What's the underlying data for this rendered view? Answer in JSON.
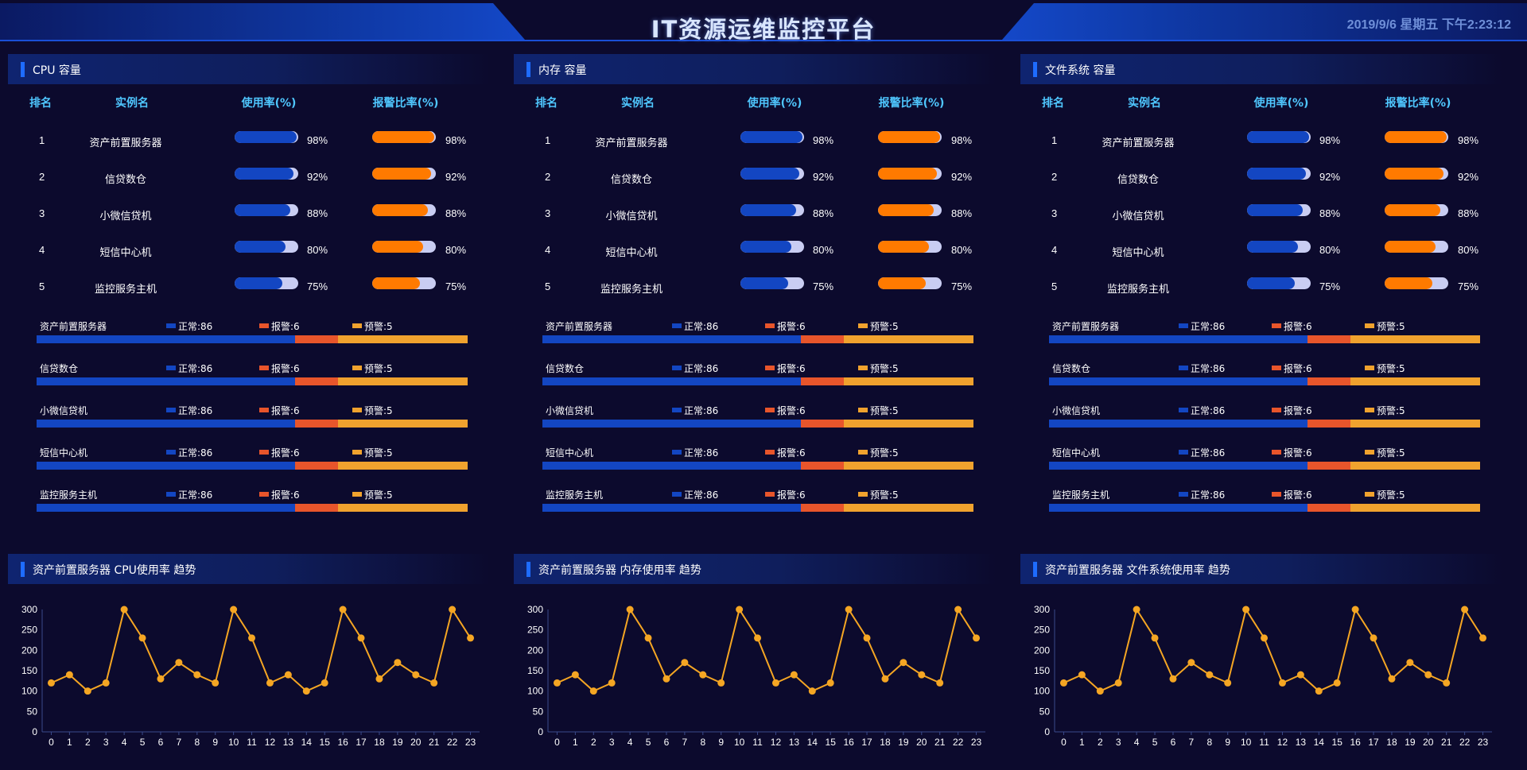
{
  "header": {
    "title": "IT资源运维监控平台",
    "datetime": "2019/9/6 星期五 下午2:23:12"
  },
  "colors": {
    "usage": "#1346c2",
    "alarm": "#ff7a00",
    "track": "#c9cdf2",
    "normal": "#1346c2",
    "warn": "#e8552b",
    "pre": "#f0a22e",
    "line": "#f5a623"
  },
  "columns": {
    "rank": "排名",
    "name": "实例名",
    "usage": "使用率(%)",
    "alarm": "报警比率(%)"
  },
  "panels": [
    {
      "title": "CPU 容量",
      "trend_title": "资产前置服务器 CPU使用率 趋势",
      "rows": [
        {
          "rank": "1",
          "name": "资产前置服务器",
          "usage": 98,
          "usage_text": "98%",
          "alarm": 98,
          "alarm_text": "98%"
        },
        {
          "rank": "2",
          "name": "信贷数仓",
          "usage": 92,
          "usage_text": "92%",
          "alarm": 92,
          "alarm_text": "92%"
        },
        {
          "rank": "3",
          "name": "小微信贷机",
          "usage": 88,
          "usage_text": "88%",
          "alarm": 88,
          "alarm_text": "88%"
        },
        {
          "rank": "4",
          "name": "短信中心机",
          "usage": 80,
          "usage_text": "80%",
          "alarm": 80,
          "alarm_text": "80%"
        },
        {
          "rank": "5",
          "name": "监控服务主机",
          "usage": 75,
          "usage_text": "75%",
          "alarm": 75,
          "alarm_text": "75%"
        }
      ],
      "stats": [
        {
          "name": "资产前置服务器",
          "normal": "正常:86",
          "warn": "报警:6",
          "pre": "预警:5"
        },
        {
          "name": "信贷数仓",
          "normal": "正常:86",
          "warn": "报警:6",
          "pre": "预警:5"
        },
        {
          "name": "小微信贷机",
          "normal": "正常:86",
          "warn": "报警:6",
          "pre": "预警:5"
        },
        {
          "name": "短信中心机",
          "normal": "正常:86",
          "warn": "报警:6",
          "pre": "预警:5"
        },
        {
          "name": "监控服务主机",
          "normal": "正常:86",
          "warn": "报警:6",
          "pre": "预警:5"
        }
      ]
    },
    {
      "title": "内存 容量",
      "trend_title": "资产前置服务器 内存使用率 趋势",
      "rows": [
        {
          "rank": "1",
          "name": "资产前置服务器",
          "usage": 98,
          "usage_text": "98%",
          "alarm": 98,
          "alarm_text": "98%"
        },
        {
          "rank": "2",
          "name": "信贷数仓",
          "usage": 92,
          "usage_text": "92%",
          "alarm": 92,
          "alarm_text": "92%"
        },
        {
          "rank": "3",
          "name": "小微信贷机",
          "usage": 88,
          "usage_text": "88%",
          "alarm": 88,
          "alarm_text": "88%"
        },
        {
          "rank": "4",
          "name": "短信中心机",
          "usage": 80,
          "usage_text": "80%",
          "alarm": 80,
          "alarm_text": "80%"
        },
        {
          "rank": "5",
          "name": "监控服务主机",
          "usage": 75,
          "usage_text": "75%",
          "alarm": 75,
          "alarm_text": "75%"
        }
      ],
      "stats": [
        {
          "name": "资产前置服务器",
          "normal": "正常:86",
          "warn": "报警:6",
          "pre": "预警:5"
        },
        {
          "name": "信贷数仓",
          "normal": "正常:86",
          "warn": "报警:6",
          "pre": "预警:5"
        },
        {
          "name": "小微信贷机",
          "normal": "正常:86",
          "warn": "报警:6",
          "pre": "预警:5"
        },
        {
          "name": "短信中心机",
          "normal": "正常:86",
          "warn": "报警:6",
          "pre": "预警:5"
        },
        {
          "name": "监控服务主机",
          "normal": "正常:86",
          "warn": "报警:6",
          "pre": "预警:5"
        }
      ]
    },
    {
      "title": "文件系统 容量",
      "trend_title": "资产前置服务器 文件系统使用率 趋势",
      "rows": [
        {
          "rank": "1",
          "name": "资产前置服务器",
          "usage": 98,
          "usage_text": "98%",
          "alarm": 98,
          "alarm_text": "98%"
        },
        {
          "rank": "2",
          "name": "信贷数仓",
          "usage": 92,
          "usage_text": "92%",
          "alarm": 92,
          "alarm_text": "92%"
        },
        {
          "rank": "3",
          "name": "小微信贷机",
          "usage": 88,
          "usage_text": "88%",
          "alarm": 88,
          "alarm_text": "88%"
        },
        {
          "rank": "4",
          "name": "短信中心机",
          "usage": 80,
          "usage_text": "80%",
          "alarm": 80,
          "alarm_text": "80%"
        },
        {
          "rank": "5",
          "name": "监控服务主机",
          "usage": 75,
          "usage_text": "75%",
          "alarm": 75,
          "alarm_text": "75%"
        }
      ],
      "stats": [
        {
          "name": "资产前置服务器",
          "normal": "正常:86",
          "warn": "报警:6",
          "pre": "预警:5"
        },
        {
          "name": "信贷数仓",
          "normal": "正常:86",
          "warn": "报警:6",
          "pre": "预警:5"
        },
        {
          "name": "小微信贷机",
          "normal": "正常:86",
          "warn": "报警:6",
          "pre": "预警:5"
        },
        {
          "name": "短信中心机",
          "normal": "正常:86",
          "warn": "报警:6",
          "pre": "预警:5"
        },
        {
          "name": "监控服务主机",
          "normal": "正常:86",
          "warn": "报警:6",
          "pre": "预警:5"
        }
      ]
    }
  ],
  "stat_shares": {
    "normal": 60,
    "warn": 10,
    "pre": 30
  },
  "chart_data": [
    {
      "type": "line",
      "x": [
        "0",
        "1",
        "2",
        "3",
        "4",
        "5",
        "6",
        "7",
        "8",
        "9",
        "10",
        "11",
        "12",
        "13",
        "14",
        "15",
        "16",
        "17",
        "18",
        "19",
        "20",
        "21",
        "22",
        "23"
      ],
      "series": [
        {
          "values": [
            120,
            140,
            100,
            120,
            300,
            230,
            130,
            170,
            140,
            120,
            300,
            230,
            120,
            140,
            100,
            120,
            300,
            230,
            130,
            170,
            140,
            120,
            300,
            230
          ]
        }
      ],
      "ylim": [
        0,
        300
      ],
      "yticks": [
        "0",
        "50",
        "100",
        "150",
        "200",
        "250",
        "300"
      ],
      "grid": false
    },
    {
      "type": "line",
      "x": [
        "0",
        "1",
        "2",
        "3",
        "4",
        "5",
        "6",
        "7",
        "8",
        "9",
        "10",
        "11",
        "12",
        "13",
        "14",
        "15",
        "16",
        "17",
        "18",
        "19",
        "20",
        "21",
        "22",
        "23"
      ],
      "series": [
        {
          "values": [
            120,
            140,
            100,
            120,
            300,
            230,
            130,
            170,
            140,
            120,
            300,
            230,
            120,
            140,
            100,
            120,
            300,
            230,
            130,
            170,
            140,
            120,
            300,
            230
          ]
        }
      ],
      "ylim": [
        0,
        300
      ],
      "yticks": [
        "0",
        "50",
        "100",
        "150",
        "200",
        "250",
        "300"
      ],
      "grid": false
    },
    {
      "type": "line",
      "x": [
        "0",
        "1",
        "2",
        "3",
        "4",
        "5",
        "6",
        "7",
        "8",
        "9",
        "10",
        "11",
        "12",
        "13",
        "14",
        "15",
        "16",
        "17",
        "18",
        "19",
        "20",
        "21",
        "22",
        "23"
      ],
      "series": [
        {
          "values": [
            120,
            140,
            100,
            120,
            300,
            230,
            130,
            170,
            140,
            120,
            300,
            230,
            120,
            140,
            100,
            120,
            300,
            230,
            130,
            170,
            140,
            120,
            300,
            230
          ]
        }
      ],
      "ylim": [
        0,
        300
      ],
      "yticks": [
        "0",
        "50",
        "100",
        "150",
        "200",
        "250",
        "300"
      ],
      "grid": false
    }
  ]
}
